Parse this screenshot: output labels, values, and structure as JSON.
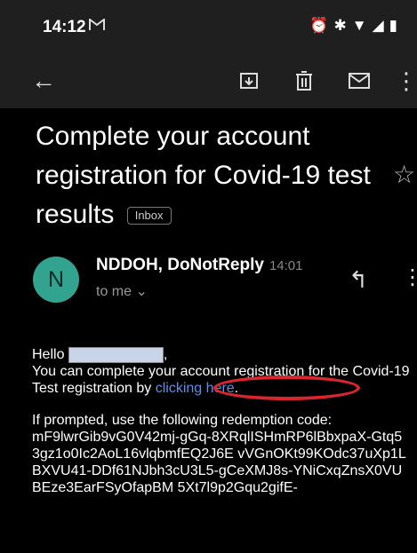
{
  "status": {
    "time": "14:12",
    "mail_icon": "M",
    "icons": "⏰ ✱ ▼ ◢ ▮"
  },
  "toolbar": {
    "back_icon": "←",
    "archive_icon": "archive",
    "delete_icon": "delete",
    "mail_icon": "mail",
    "more_icon": "⋮"
  },
  "email": {
    "subject": "Complete your account registration for Covid-19 test results",
    "label": "Inbox",
    "sender": {
      "initial": "N",
      "name": "NDDOH, DoNotReply",
      "time": "14:01",
      "to": "to me"
    },
    "body": {
      "greeting": "Hello",
      "line1": "You can complete your account registration for the Covid-19 Test registration by",
      "link_text": "clicking here",
      "line2": "If prompted, use the following redemption code:",
      "code": "mF9lwrGib9vG0V42mj-gGq-8XRqlISHmRP6lBbxpaX-Gtq53gz1o0Ic2AoL16vlqbmfEQ2J6E vVGnOKt99KOdc37uXp1LBXVU41-DDf61NJbh3cU3L5-gCeXMJ8s-YNiCxqZnsX0VUBEze3EarFSyOfapBM 5Xt7l9p2Gqu2gifE-"
    }
  }
}
